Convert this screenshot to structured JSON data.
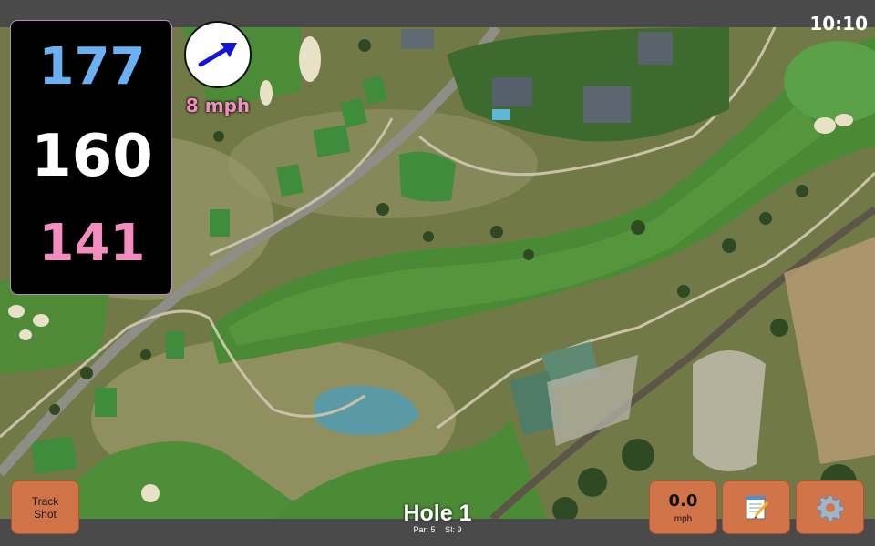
{
  "status": {
    "time": "10:10"
  },
  "distances": {
    "back": "177",
    "middle": "160",
    "front": "141",
    "colors": {
      "back": "#6ab0f3",
      "middle": "#ffffff",
      "front": "#f38dbf"
    }
  },
  "wind": {
    "speed_label": "8 mph",
    "direction_icon": "wind-arrow-icon",
    "arrow_color": "#1414d8",
    "speed_color": "#f38dbf"
  },
  "hole": {
    "title": "Hole 1",
    "par": "Par: 5",
    "si": "SI: 9"
  },
  "buttons": {
    "track_shot": [
      "Track",
      "Shot"
    ],
    "wind_value": "0.0",
    "wind_unit": "mph",
    "notes_icon": "notepad-icon",
    "settings_icon": "gear-icon",
    "accent": "#d2744a"
  },
  "map": {
    "type": "satellite-course-view",
    "colors": {
      "rough": "#6f7a45",
      "fairway": "#4f8a37",
      "green": "#4c9a3e",
      "water": "#5a9aa6",
      "path": "#c9c2a8",
      "road": "#8a8a82"
    }
  }
}
